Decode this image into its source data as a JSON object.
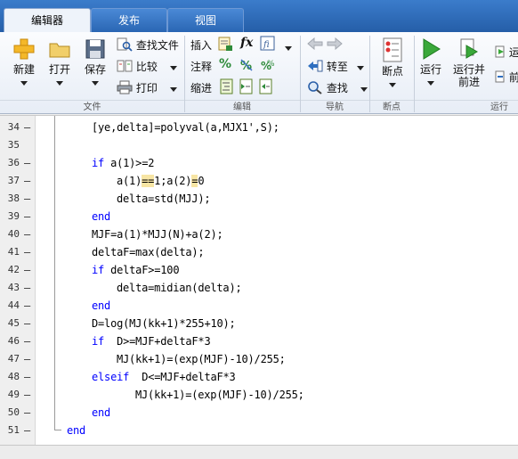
{
  "tabs": [
    {
      "label": "编辑器",
      "active": true
    },
    {
      "label": "发布",
      "active": false
    },
    {
      "label": "视图",
      "active": false
    }
  ],
  "ribbon": {
    "file": {
      "new_label": "新建",
      "open_label": "打开",
      "save_label": "保存",
      "find_files_label": "查找文件",
      "compare_label": "比较",
      "print_label": "打印",
      "section_label": "文件"
    },
    "edit": {
      "insert_label": "插入",
      "comment_label": "注释",
      "indent_label": "缩进",
      "section_label": "编辑"
    },
    "navigate": {
      "goto_label": "转至",
      "find_label": "查找",
      "section_label": "导航"
    },
    "breakpoints": {
      "breakpoints_label": "断点",
      "section_label": "断点"
    },
    "run": {
      "run_label": "运行",
      "run_advance_label_1": "运行并",
      "run_advance_label_2": "前进",
      "run_section_label": "运",
      "advance_label": "前",
      "section_label": "运行"
    }
  },
  "code_lines": [
    {
      "num": "34",
      "text": "[ye,delta]=polyval(a,MJX1',S);"
    },
    {
      "num": "35",
      "text": ""
    },
    {
      "num": "36",
      "text": "if a(1)>=2"
    },
    {
      "num": "37",
      "text": "a(1)==1;a(2)=0"
    },
    {
      "num": "38",
      "text": "delta=std(MJJ);"
    },
    {
      "num": "39",
      "text": "end"
    },
    {
      "num": "40",
      "text": "MJF=a(1)*MJJ(N)+a(2);"
    },
    {
      "num": "41",
      "text": "deltaF=max(delta);"
    },
    {
      "num": "42",
      "text": "if deltaF>=100"
    },
    {
      "num": "43",
      "text": "delta=midian(delta);"
    },
    {
      "num": "44",
      "text": "end"
    },
    {
      "num": "45",
      "text": "D=log(MJ(kk+1)*255+10);"
    },
    {
      "num": "46",
      "text": "if  D>=MJF+deltaF*3"
    },
    {
      "num": "47",
      "text": "MJ(kk+1)=(exp(MJF)-10)/255;"
    },
    {
      "num": "48",
      "text": "elseif  D<=MJF+deltaF*3"
    },
    {
      "num": "49",
      "text": "MJ(kk+1)=(exp(MJF)-10)/255;"
    },
    {
      "num": "50",
      "text": "end"
    },
    {
      "num": "51",
      "text": "end"
    }
  ],
  "colors": {
    "tab_bar": "#2e6cb8",
    "keyword": "#0000ff",
    "highlight": "#f7e5a4"
  }
}
